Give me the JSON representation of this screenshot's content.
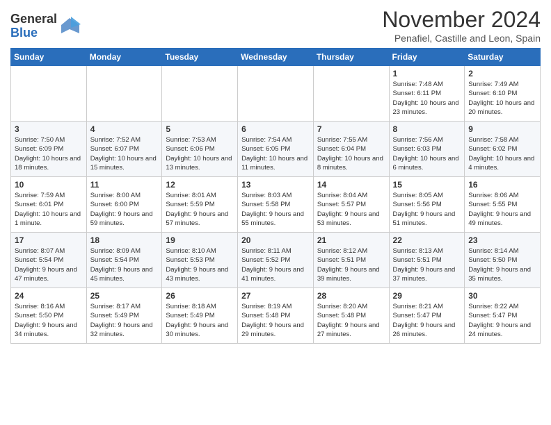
{
  "logo": {
    "general": "General",
    "blue": "Blue"
  },
  "header": {
    "month": "November 2024",
    "location": "Penafiel, Castille and Leon, Spain"
  },
  "days_of_week": [
    "Sunday",
    "Monday",
    "Tuesday",
    "Wednesday",
    "Thursday",
    "Friday",
    "Saturday"
  ],
  "weeks": [
    [
      {
        "day": "",
        "info": ""
      },
      {
        "day": "",
        "info": ""
      },
      {
        "day": "",
        "info": ""
      },
      {
        "day": "",
        "info": ""
      },
      {
        "day": "",
        "info": ""
      },
      {
        "day": "1",
        "info": "Sunrise: 7:48 AM\nSunset: 6:11 PM\nDaylight: 10 hours and 23 minutes."
      },
      {
        "day": "2",
        "info": "Sunrise: 7:49 AM\nSunset: 6:10 PM\nDaylight: 10 hours and 20 minutes."
      }
    ],
    [
      {
        "day": "3",
        "info": "Sunrise: 7:50 AM\nSunset: 6:09 PM\nDaylight: 10 hours and 18 minutes."
      },
      {
        "day": "4",
        "info": "Sunrise: 7:52 AM\nSunset: 6:07 PM\nDaylight: 10 hours and 15 minutes."
      },
      {
        "day": "5",
        "info": "Sunrise: 7:53 AM\nSunset: 6:06 PM\nDaylight: 10 hours and 13 minutes."
      },
      {
        "day": "6",
        "info": "Sunrise: 7:54 AM\nSunset: 6:05 PM\nDaylight: 10 hours and 11 minutes."
      },
      {
        "day": "7",
        "info": "Sunrise: 7:55 AM\nSunset: 6:04 PM\nDaylight: 10 hours and 8 minutes."
      },
      {
        "day": "8",
        "info": "Sunrise: 7:56 AM\nSunset: 6:03 PM\nDaylight: 10 hours and 6 minutes."
      },
      {
        "day": "9",
        "info": "Sunrise: 7:58 AM\nSunset: 6:02 PM\nDaylight: 10 hours and 4 minutes."
      }
    ],
    [
      {
        "day": "10",
        "info": "Sunrise: 7:59 AM\nSunset: 6:01 PM\nDaylight: 10 hours and 1 minute."
      },
      {
        "day": "11",
        "info": "Sunrise: 8:00 AM\nSunset: 6:00 PM\nDaylight: 9 hours and 59 minutes."
      },
      {
        "day": "12",
        "info": "Sunrise: 8:01 AM\nSunset: 5:59 PM\nDaylight: 9 hours and 57 minutes."
      },
      {
        "day": "13",
        "info": "Sunrise: 8:03 AM\nSunset: 5:58 PM\nDaylight: 9 hours and 55 minutes."
      },
      {
        "day": "14",
        "info": "Sunrise: 8:04 AM\nSunset: 5:57 PM\nDaylight: 9 hours and 53 minutes."
      },
      {
        "day": "15",
        "info": "Sunrise: 8:05 AM\nSunset: 5:56 PM\nDaylight: 9 hours and 51 minutes."
      },
      {
        "day": "16",
        "info": "Sunrise: 8:06 AM\nSunset: 5:55 PM\nDaylight: 9 hours and 49 minutes."
      }
    ],
    [
      {
        "day": "17",
        "info": "Sunrise: 8:07 AM\nSunset: 5:54 PM\nDaylight: 9 hours and 47 minutes."
      },
      {
        "day": "18",
        "info": "Sunrise: 8:09 AM\nSunset: 5:54 PM\nDaylight: 9 hours and 45 minutes."
      },
      {
        "day": "19",
        "info": "Sunrise: 8:10 AM\nSunset: 5:53 PM\nDaylight: 9 hours and 43 minutes."
      },
      {
        "day": "20",
        "info": "Sunrise: 8:11 AM\nSunset: 5:52 PM\nDaylight: 9 hours and 41 minutes."
      },
      {
        "day": "21",
        "info": "Sunrise: 8:12 AM\nSunset: 5:51 PM\nDaylight: 9 hours and 39 minutes."
      },
      {
        "day": "22",
        "info": "Sunrise: 8:13 AM\nSunset: 5:51 PM\nDaylight: 9 hours and 37 minutes."
      },
      {
        "day": "23",
        "info": "Sunrise: 8:14 AM\nSunset: 5:50 PM\nDaylight: 9 hours and 35 minutes."
      }
    ],
    [
      {
        "day": "24",
        "info": "Sunrise: 8:16 AM\nSunset: 5:50 PM\nDaylight: 9 hours and 34 minutes."
      },
      {
        "day": "25",
        "info": "Sunrise: 8:17 AM\nSunset: 5:49 PM\nDaylight: 9 hours and 32 minutes."
      },
      {
        "day": "26",
        "info": "Sunrise: 8:18 AM\nSunset: 5:49 PM\nDaylight: 9 hours and 30 minutes."
      },
      {
        "day": "27",
        "info": "Sunrise: 8:19 AM\nSunset: 5:48 PM\nDaylight: 9 hours and 29 minutes."
      },
      {
        "day": "28",
        "info": "Sunrise: 8:20 AM\nSunset: 5:48 PM\nDaylight: 9 hours and 27 minutes."
      },
      {
        "day": "29",
        "info": "Sunrise: 8:21 AM\nSunset: 5:47 PM\nDaylight: 9 hours and 26 minutes."
      },
      {
        "day": "30",
        "info": "Sunrise: 8:22 AM\nSunset: 5:47 PM\nDaylight: 9 hours and 24 minutes."
      }
    ]
  ]
}
